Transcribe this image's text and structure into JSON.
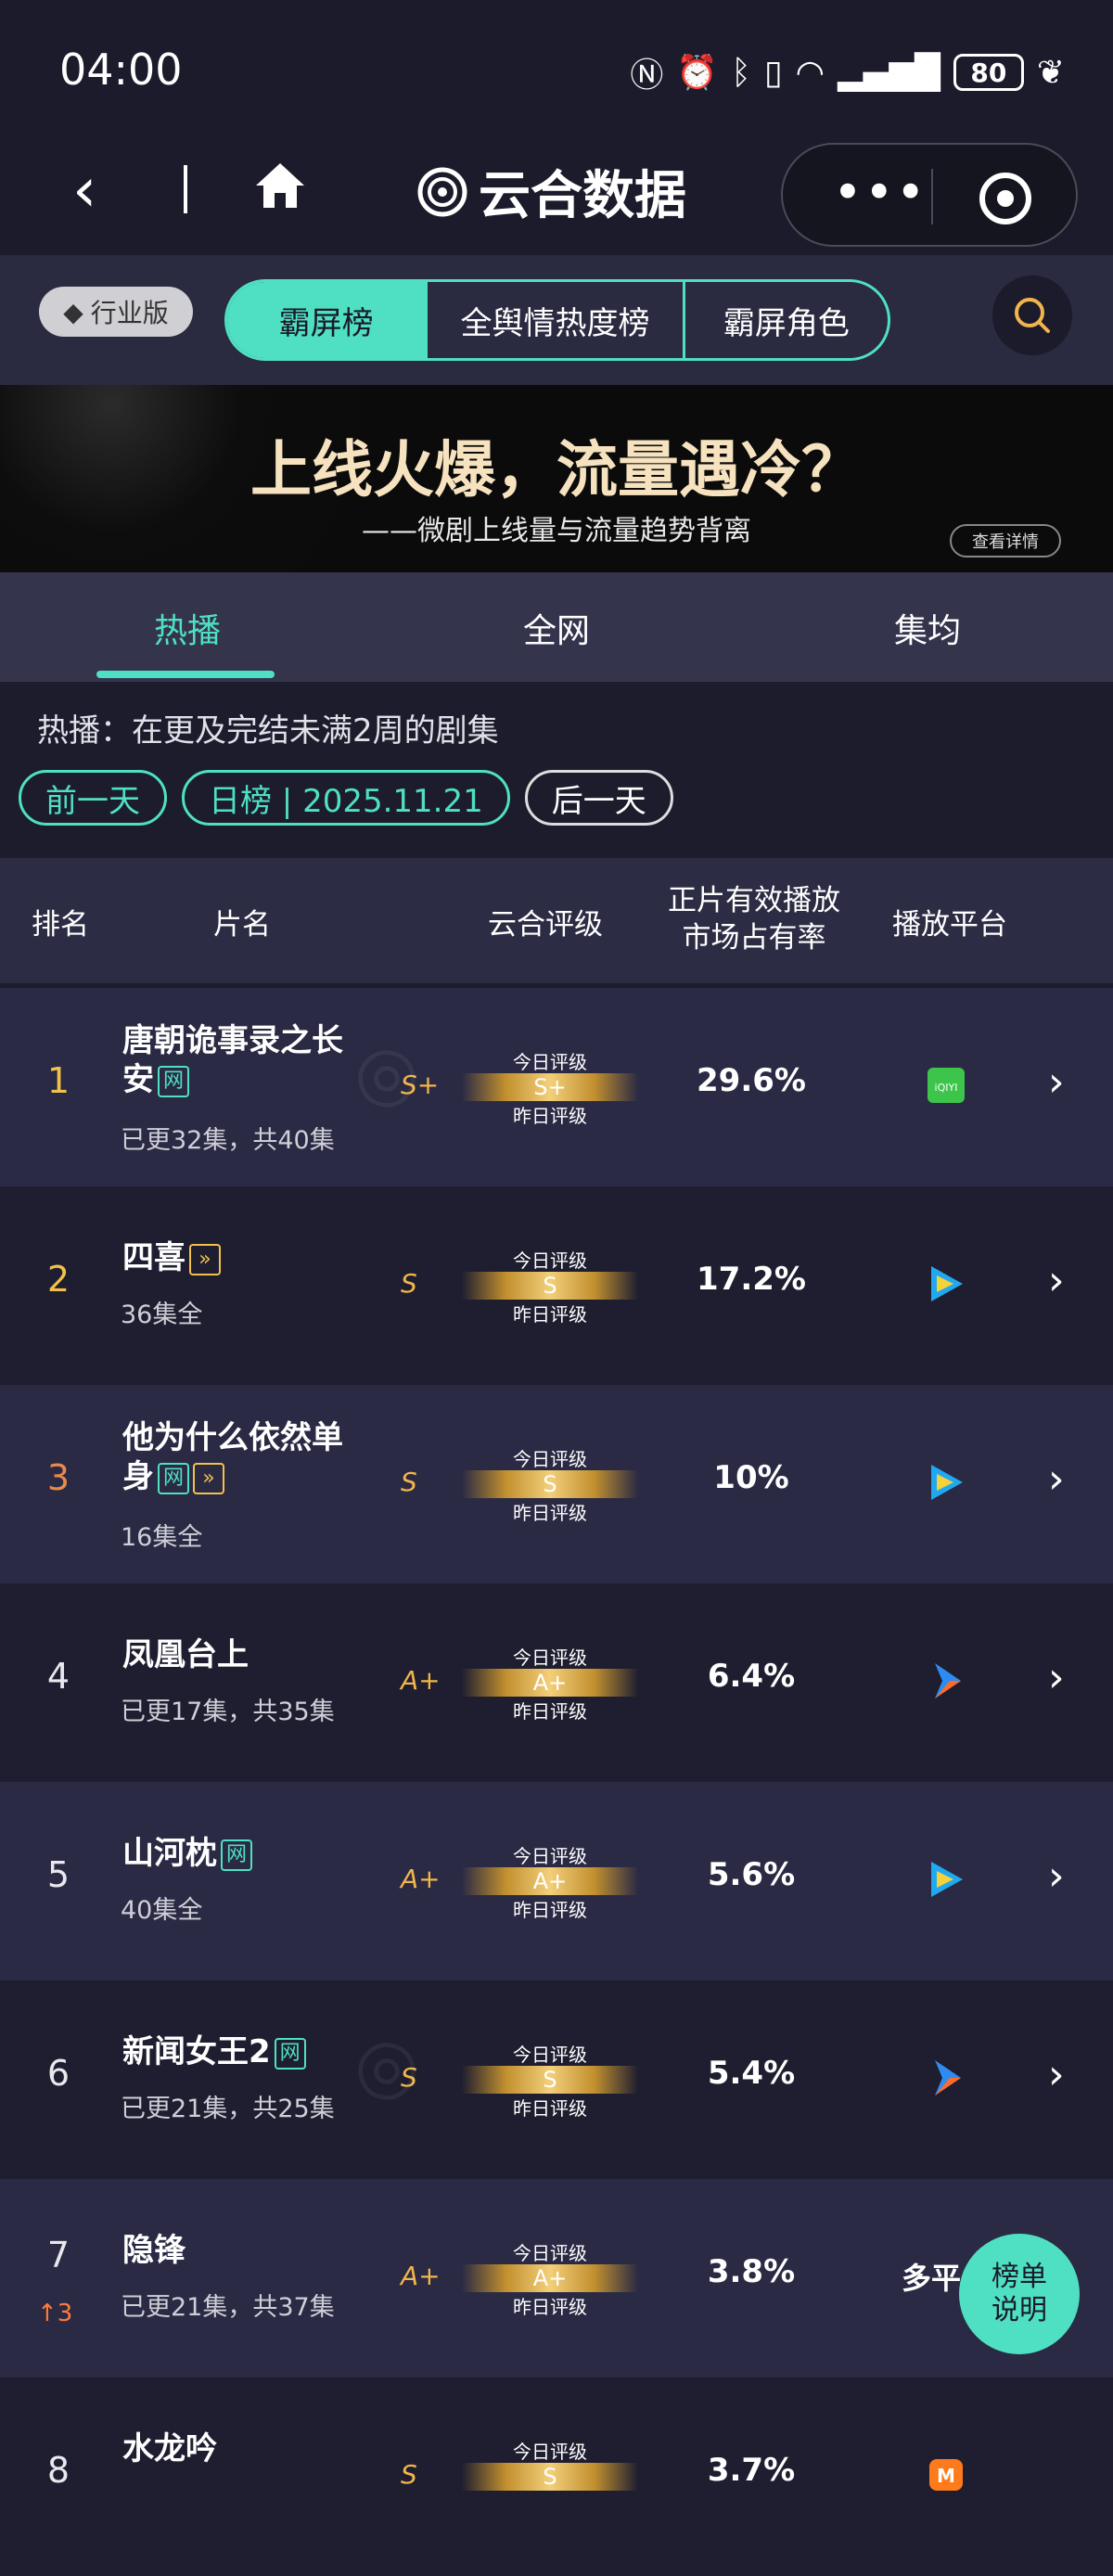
{
  "status": {
    "time": "04:00",
    "battery": "80"
  },
  "nav": {
    "title": "云合数据"
  },
  "header": {
    "industry_label": "行业版",
    "segments": [
      "霸屏榜",
      "全舆情热度榜",
      "霸屏角色"
    ]
  },
  "banner": {
    "title": "上线火爆，流量遇冷？",
    "subtitle": "——微剧上线量与流量趋势背离",
    "button": "查看详情"
  },
  "subtabs": [
    "热播",
    "全网",
    "集均"
  ],
  "description": "热播：在更及完结未满2周的剧集",
  "datebar": {
    "prev": "前一天",
    "current": "日榜 | 2025.11.21",
    "next": "后一天"
  },
  "table_header": {
    "rank": "排名",
    "name": "片名",
    "grade": "云合评级",
    "share_line1": "正片有效播放",
    "share_line2": "市场占有率",
    "platform": "播放平台"
  },
  "meter_labels": {
    "today": "今日评级",
    "yesterday": "昨日评级"
  },
  "rows": [
    {
      "rank": "1",
      "title": "唐朝诡事录之长安",
      "tags": [
        "网"
      ],
      "sub": "已更32集，共40集",
      "grade": "S+",
      "share": "29.6%",
      "platform": "iqiyi"
    },
    {
      "rank": "2",
      "title": "四喜",
      "tags": [
        "vip"
      ],
      "sub": "36集全",
      "grade": "S",
      "share": "17.2%",
      "platform": "tencent"
    },
    {
      "rank": "3",
      "title": "他为什么依然单身",
      "tags": [
        "网",
        "vip"
      ],
      "sub": "16集全",
      "grade": "S",
      "share": "10%",
      "platform": "tencent"
    },
    {
      "rank": "4",
      "title": "凤凰台上",
      "tags": [],
      "sub": "已更17集，共35集",
      "grade": "A+",
      "share": "6.4%",
      "platform": "youku"
    },
    {
      "rank": "5",
      "title": "山河枕",
      "tags": [
        "网"
      ],
      "sub": "40集全",
      "grade": "A+",
      "share": "5.6%",
      "platform": "tencent"
    },
    {
      "rank": "6",
      "title": "新闻女王2",
      "tags": [
        "网"
      ],
      "sub": "已更21集，共25集",
      "grade": "S",
      "share": "5.4%",
      "platform": "youku"
    },
    {
      "rank": "7",
      "title": "隐锋",
      "tags": [],
      "sub": "已更21集，共37集",
      "grade": "A+",
      "share": "3.8%",
      "platform_text": "多平台",
      "rank_change": "3"
    },
    {
      "rank": "8",
      "title": "水龙吟",
      "tags": [],
      "sub": "",
      "grade": "S",
      "share": "3.7%",
      "platform": "mango"
    }
  ],
  "float_button": {
    "line1": "榜单",
    "line2": "说明"
  },
  "colors": {
    "accent": "#4fe0c3",
    "gold": "#f1c14b",
    "bronze": "#e88a4a",
    "bg": "#1c1c2c"
  }
}
